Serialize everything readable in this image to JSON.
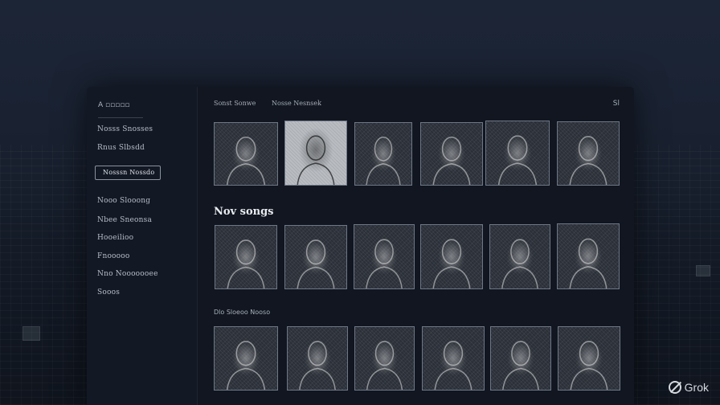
{
  "sidebar": {
    "title": "A ▫▫▫▫▫",
    "items": [
      "Nosss Snosses",
      "Rnus Slbsdd",
      "Nosssn Nossdo",
      "Nooo Slooong",
      "Nbee Sneonsa",
      "Hooeilioo",
      "Fnooooo",
      "Nno Nooooooee",
      "Sooos"
    ]
  },
  "header": {
    "tabs": [
      "Sonst Sonwe",
      "Nosse Nesnsek"
    ],
    "corner": "Sl"
  },
  "sections": {
    "new_songs": "Nov songs",
    "third": "Dlo Sloeoo Nooso"
  },
  "rows": {
    "top": [
      "portrait",
      "figure-walking",
      "tree-sculpture",
      "tree-sculpture-2",
      "woman-portrait",
      "figure-statue"
    ],
    "new_songs": [
      "woman-portrait",
      "woman-portrait",
      "woman-portrait",
      "woman-portrait",
      "figure-statue",
      "woman-portrait"
    ],
    "bottom": [
      "woman-portrait",
      "woman-portrait",
      "woman-portrait",
      "woman-portrait",
      "woman-portrait",
      "woman-portrait"
    ]
  },
  "watermark": "Grok"
}
